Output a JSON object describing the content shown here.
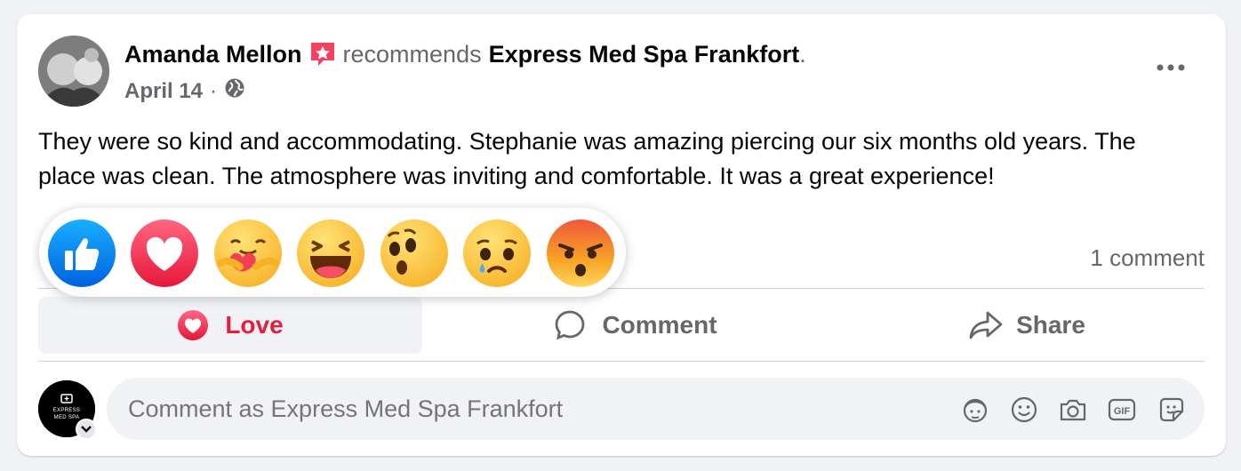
{
  "post": {
    "author": "Amanda Mellon",
    "verb": "recommends",
    "page_name": "Express Med Spa Frankfort",
    "trailing": ".",
    "date": "April 14",
    "separator": "·",
    "body": "They were so kind and accommodating. Stephanie was amazing piercing our six months old years. The place was clean. The atmosphere was inviting and comfortable. It was a great experience!",
    "comment_count": "1 comment"
  },
  "actions": {
    "love": "Love",
    "comment": "Comment",
    "share": "Share"
  },
  "composer": {
    "placeholder": "Comment as Express Med Spa Frankfort",
    "avatar_text": "EXPRESS MED SPA"
  },
  "reactions": [
    "like",
    "love",
    "care",
    "haha",
    "wow",
    "sad",
    "angry"
  ],
  "icons": {
    "badge": "recommend-star-icon",
    "privacy": "globe-icon",
    "more": "more-dots-icon",
    "composer_icons": [
      "avatar-sticker-icon",
      "emoji-icon",
      "camera-icon",
      "gif-icon",
      "sticker-icon"
    ]
  },
  "colors": {
    "love": "#e41e3f",
    "like": "#1877f2",
    "muted": "#65676b",
    "badge": "#f3425f"
  }
}
